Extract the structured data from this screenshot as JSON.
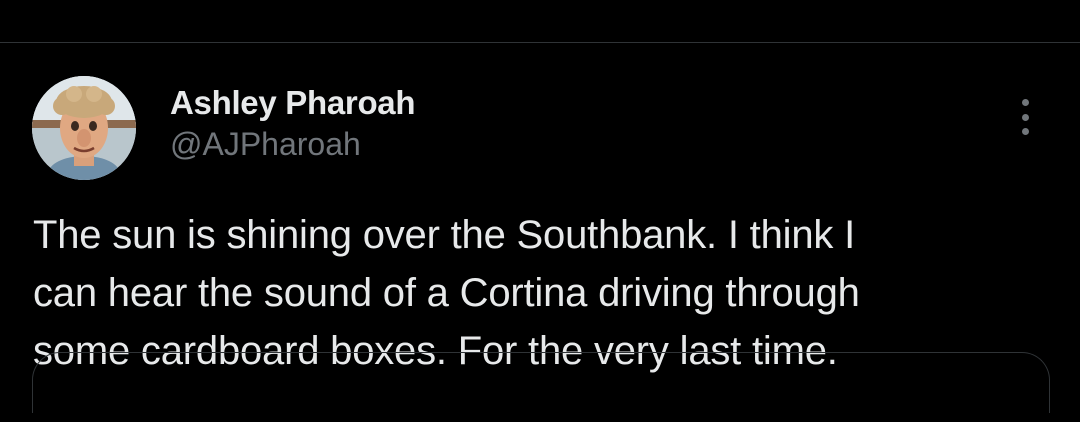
{
  "tweet": {
    "author": {
      "display_name": "Ashley Pharoah",
      "handle": "@AJPharoah",
      "avatar_icon": "cartoon-portrait-avatar"
    },
    "more_icon": "more-options-vertical-icon",
    "text_lines": [
      "The sun is shining over the Southbank. I think I",
      "can hear the sound of a Cortina driving through",
      "some cardboard boxes. For the very last time."
    ]
  },
  "colors": {
    "background": "#000000",
    "primary_text": "#e7e9ea",
    "secondary_text": "#71767b",
    "divider": "#2f3336"
  }
}
